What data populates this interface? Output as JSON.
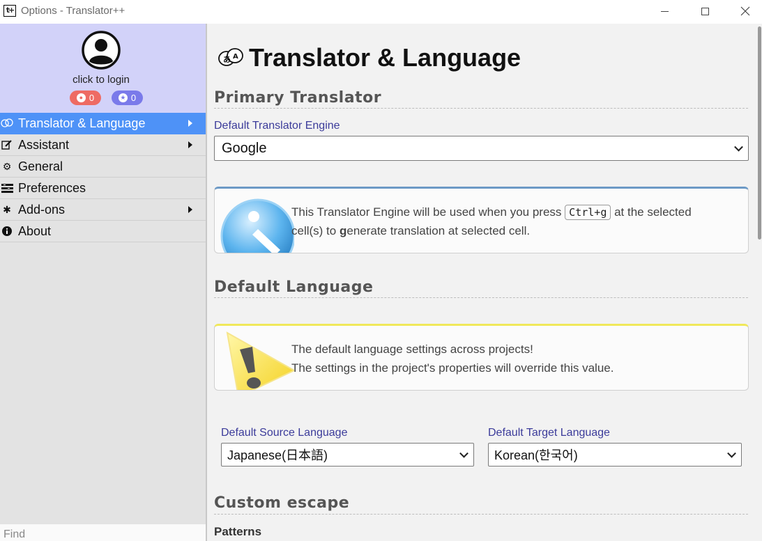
{
  "window": {
    "title": "Options - Translator++",
    "app_icon": "t+"
  },
  "sidebar": {
    "login_text": "click to login",
    "badges": [
      {
        "name": "red-badge",
        "value": "0",
        "color": "#ee6b64"
      },
      {
        "name": "blue-badge",
        "value": "0",
        "color": "#7a7aea"
      }
    ],
    "items": [
      {
        "label": "Translator & Language",
        "icon": "translate-icon",
        "has_arrow": true,
        "active": true
      },
      {
        "label": "Assistant",
        "icon": "edit-icon",
        "has_arrow": true,
        "active": false
      },
      {
        "label": "General",
        "icon": "gear-icon",
        "has_arrow": false,
        "active": false
      },
      {
        "label": "Preferences",
        "icon": "list-icon",
        "has_arrow": false,
        "active": false
      },
      {
        "label": "Add-ons",
        "icon": "puzzle-icon",
        "has_arrow": true,
        "active": false
      },
      {
        "label": "About",
        "icon": "info-icon",
        "has_arrow": false,
        "active": false
      }
    ],
    "find_placeholder": "Find"
  },
  "main": {
    "title": "Translator & Language",
    "primary_translator": {
      "heading": "Primary Translator",
      "engine_label": "Default Translator Engine",
      "engine_value": "Google",
      "info_text_1": "This Translator Engine will be used when you press",
      "shortcut": "Ctrl+g",
      "info_text_2": "at the selected",
      "info_text_3": "cell(s) to ",
      "info_bold": "g",
      "info_text_4": "enerate translation at selected cell."
    },
    "default_language": {
      "heading": "Default Language",
      "info_line_1": "The default language settings across projects!",
      "info_line_2": "The settings in the project's properties will override this value.",
      "source_label": "Default Source Language",
      "source_value": "Japanese(日本語)",
      "target_label": "Default Target Language",
      "target_value": "Korean(한국어)"
    },
    "custom_escape": {
      "heading": "Custom escape",
      "patterns_label": "Patterns"
    }
  },
  "colors": {
    "accent": "#4e92f7",
    "sidebar_bg": "#e3e3e3",
    "profile_bg": "#d2d2f9",
    "label_color": "#3b3b9a"
  }
}
